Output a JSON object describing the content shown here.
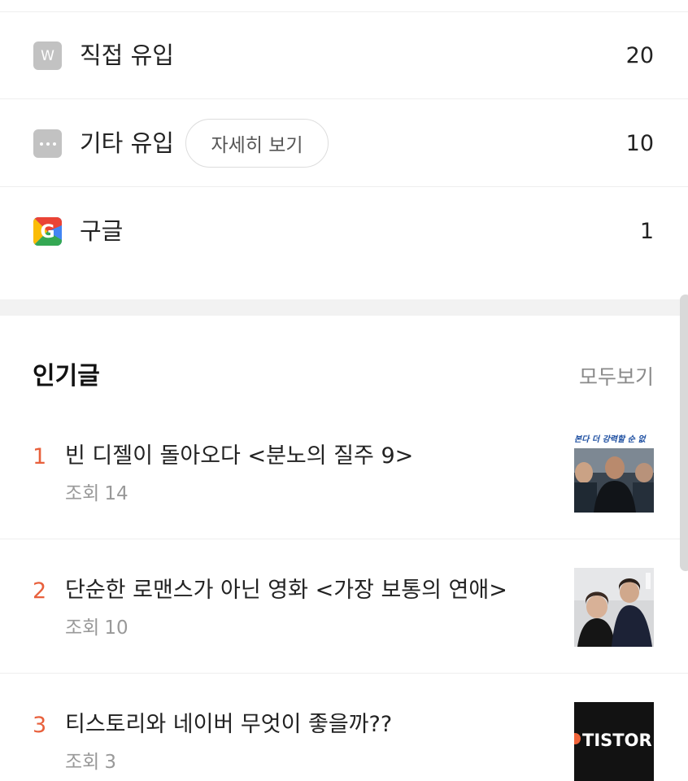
{
  "referrers": [
    {
      "icon": "web-icon",
      "icon_text": "W",
      "label": "직접 유입",
      "count": "20"
    },
    {
      "icon": "more-icon",
      "label": "기타 유입",
      "count": "10",
      "detail_button": "자세히 보기"
    },
    {
      "icon": "google-icon",
      "label": "구글",
      "count": "1"
    }
  ],
  "popular": {
    "title": "인기글",
    "see_all": "모두보기",
    "views_label": "조회",
    "posts": [
      {
        "rank": "1",
        "title": "빈 디젤이 돌아오다 <분노의 질주 9>",
        "views": "14",
        "thumb": "thumbnail-fast-and-furious",
        "thumb_caption": "본다 더 강력할 순 없"
      },
      {
        "rank": "2",
        "title": "단순한 로맨스가 아닌 영화 <가장 보통의 연애>",
        "views": "10",
        "thumb": "thumbnail-romance-movie"
      },
      {
        "rank": "3",
        "title": "티스토리와 네이버 무엇이 좋을까??",
        "views": "3",
        "thumb": "thumbnail-tistory",
        "thumb_caption": "TISTOR"
      }
    ]
  },
  "colors": {
    "rank": "#e8603c",
    "icon_gray": "#c2c2c2",
    "section_gap": "#f2f2f2",
    "muted_text": "#999999"
  }
}
